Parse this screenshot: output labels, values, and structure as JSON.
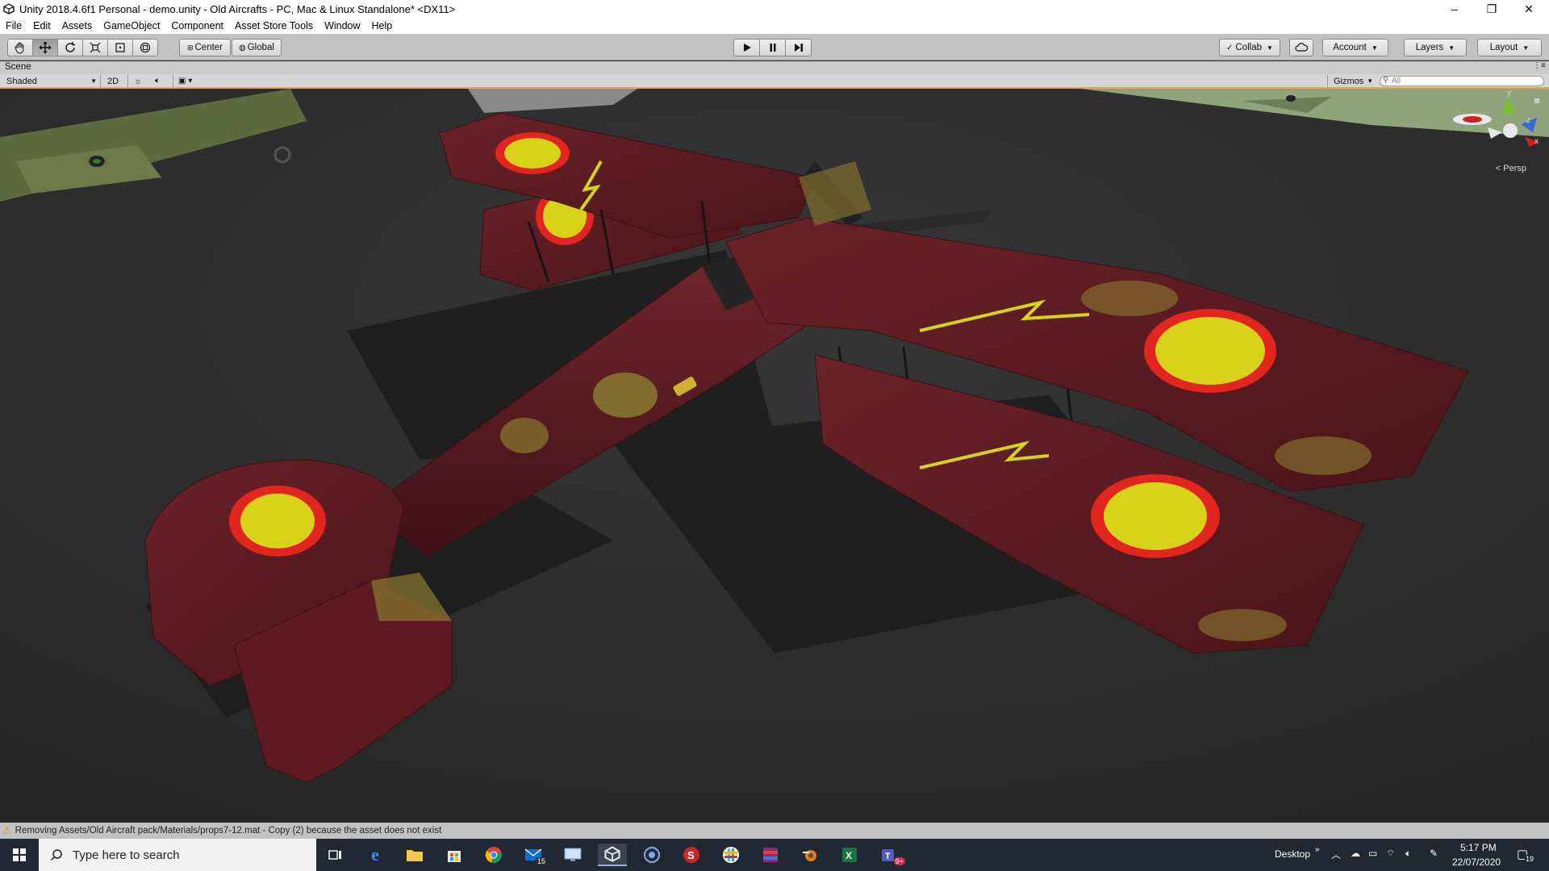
{
  "window": {
    "title": "Unity 2018.4.6f1 Personal - demo.unity - Old Aircrafts - PC, Mac & Linux Standalone* <DX11>",
    "controls": [
      "–",
      "❐",
      "✕"
    ]
  },
  "menu": [
    "File",
    "Edit",
    "Assets",
    "GameObject",
    "Component",
    "Asset Store Tools",
    "Window",
    "Help"
  ],
  "toolbar": {
    "pivot_mode": "Center",
    "pivot_rotation": "Global",
    "collab": "Collab",
    "account": "Account",
    "layers": "Layers",
    "layout": "Layout"
  },
  "scene": {
    "tab_label": "Scene",
    "shading_mode": "Shaded",
    "mode_2d": "2D",
    "gizmos": "Gizmos",
    "search_placeholder": "All",
    "projection_label": "Persp",
    "axis_labels": {
      "y": "y",
      "z": "z",
      "x": "x"
    }
  },
  "console": {
    "message": "Removing Assets/Old Aircraft pack/Materials/props7-12.mat - Copy (2) because the asset does not exist"
  },
  "taskbar": {
    "search_placeholder": "Type here to search",
    "desktop_label": "Desktop",
    "time": "5:17 PM",
    "date": "22/07/2020",
    "mail_badge": "15",
    "teams_badge": "9+",
    "notification_count": "19"
  },
  "colors": {
    "toolbar_bg": "#c2c2c2",
    "viewport_bg": "#2f2f2f",
    "plane_body": "#5a1e24",
    "roundel_yellow": "#d8d21a",
    "roundel_red": "#e2251e",
    "taskbar_bg": "#202833"
  }
}
